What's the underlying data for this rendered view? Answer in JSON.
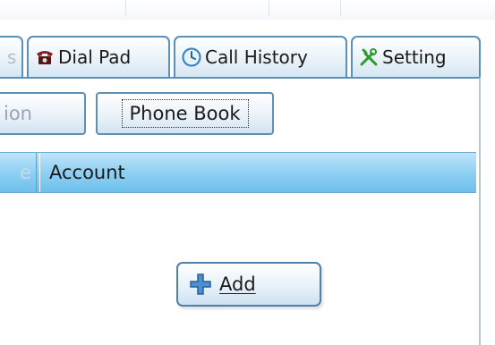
{
  "tabs": {
    "partial_label": "s",
    "dial_pad": "Dial Pad",
    "call_history": "Call History",
    "setting": "Setting"
  },
  "subtabs": {
    "partial_label": "ion",
    "phone_book": "Phone Book"
  },
  "table": {
    "partial_header": "e",
    "account_header": "Account"
  },
  "actions": {
    "add_label": "Add"
  },
  "icons": {
    "dial_pad": "telephone-icon",
    "call_history": "clock-icon",
    "setting": "tools-icon",
    "add": "plus-icon"
  },
  "colors": {
    "tab_border": "#5d90b5",
    "header_blue": "#8fd0f3",
    "plus_blue": "#3f7fbf",
    "tools_green": "#2c9a2c"
  }
}
